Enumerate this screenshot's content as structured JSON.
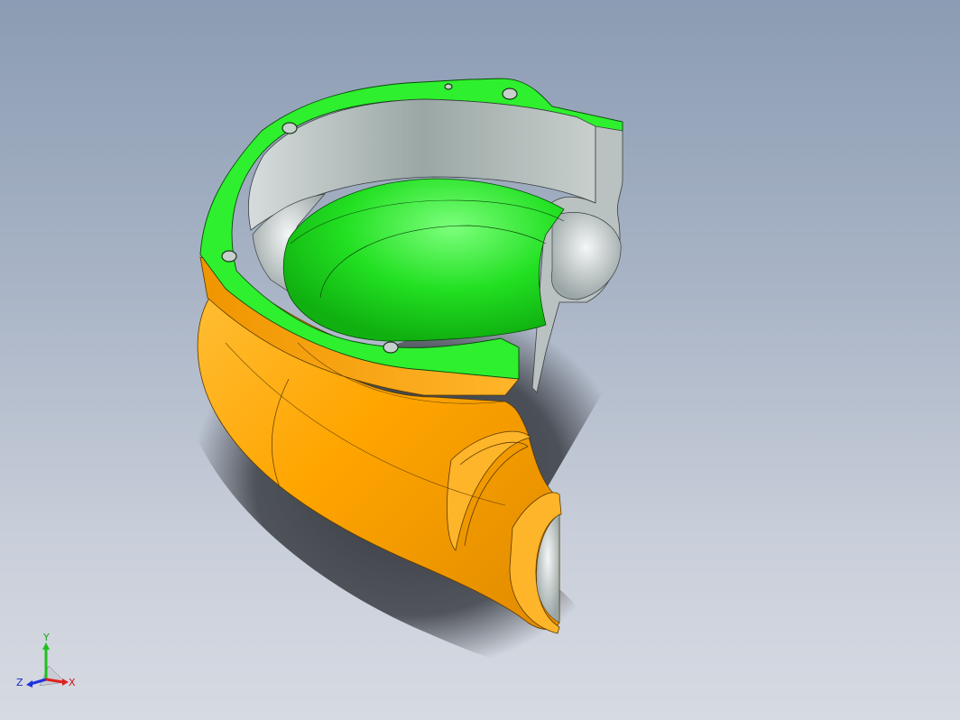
{
  "viewport": {
    "background_top": "#8b9cb3",
    "background_bottom": "#d6dae2"
  },
  "model": {
    "cut_face_color": "#2ef02e",
    "body_color": "#ffa500",
    "inner_surface_color": "#b8c2c0",
    "shadow_color": "#2a2d33",
    "bolt_hole_count": 5
  },
  "triad": {
    "x_label": "X",
    "y_label": "Y",
    "z_label": "Z",
    "x_color": "#e02020",
    "y_color": "#20c020",
    "z_color": "#2030e0"
  }
}
